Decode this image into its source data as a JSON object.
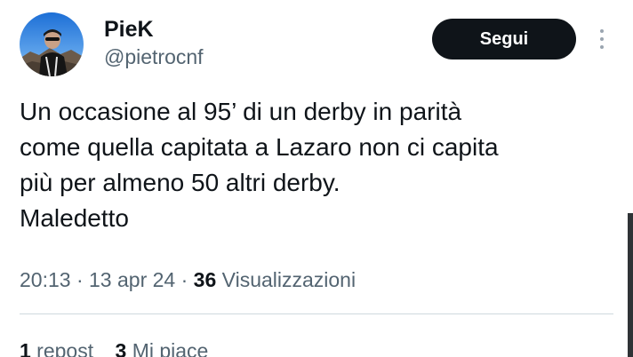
{
  "author": {
    "display_name": "PieK",
    "handle": "@pietrocnf"
  },
  "follow_button": {
    "label": "Segui"
  },
  "tweet": {
    "lines": [
      "Un occasione al 95’ di un derby in parità",
      "come quella capitata a Lazaro non ci capita",
      "più per almeno 50 altri derby.",
      "Maledetto"
    ]
  },
  "meta": {
    "time": "20:13",
    "sep1": " · ",
    "date": "13 apr 24",
    "sep2": " · ",
    "views_count": "36",
    "views_label": " Visualizzazioni"
  },
  "stats": {
    "reposts_count": "1",
    "reposts_label": " repost",
    "likes_count": "3",
    "likes_label": " Mi piace"
  },
  "icons": {
    "more": "more-vertical-icon"
  },
  "colors": {
    "text": "#0f1419",
    "secondary": "#536471",
    "button_bg": "#0f1419",
    "button_text": "#ffffff",
    "divider": "#cfd9de"
  }
}
